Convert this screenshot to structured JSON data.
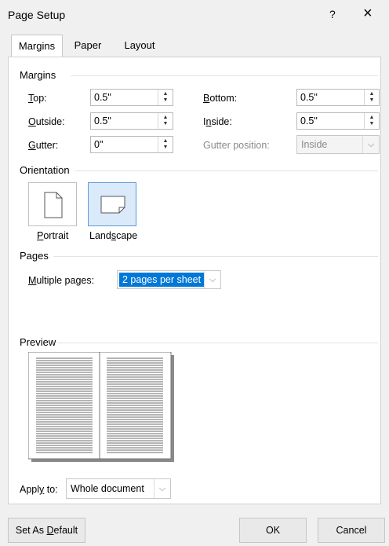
{
  "window": {
    "title": "Page Setup",
    "help": "?",
    "close": "×"
  },
  "tabs": [
    {
      "label": "Margins"
    },
    {
      "label": "Paper"
    },
    {
      "label": "Layout"
    }
  ],
  "margins": {
    "section": "Margins",
    "top": {
      "u": "T",
      "rest": "op:",
      "value": "0.5\""
    },
    "outside": {
      "u": "O",
      "rest": "utside:",
      "value": "0.5\""
    },
    "gutter": {
      "u": "G",
      "rest": "utter:",
      "value": "0\""
    },
    "bottom": {
      "u": "B",
      "rest": "ottom:",
      "value": "0.5\""
    },
    "inside": {
      "pre": "I",
      "u": "n",
      "rest": "side:",
      "value": "0.5\""
    },
    "gutter_position": {
      "label": "Gutter position:",
      "value": "Inside"
    }
  },
  "orientation": {
    "section": "Orientation",
    "portrait": {
      "u": "P",
      "rest": "ortrait"
    },
    "landscape": {
      "pre": "Land",
      "u": "s",
      "rest": "cape"
    }
  },
  "pages": {
    "section": "Pages",
    "multiple": {
      "u": "M",
      "rest": "ultiple pages:",
      "value": "2 pages per sheet"
    }
  },
  "preview": {
    "section": "Preview"
  },
  "apply_to": {
    "pre": "Appl",
    "u": "y",
    "rest": " to:",
    "value": "Whole document"
  },
  "buttons": {
    "default": {
      "pre": "Set As ",
      "u": "D",
      "rest": "efault"
    },
    "ok": "OK",
    "cancel": "Cancel"
  }
}
